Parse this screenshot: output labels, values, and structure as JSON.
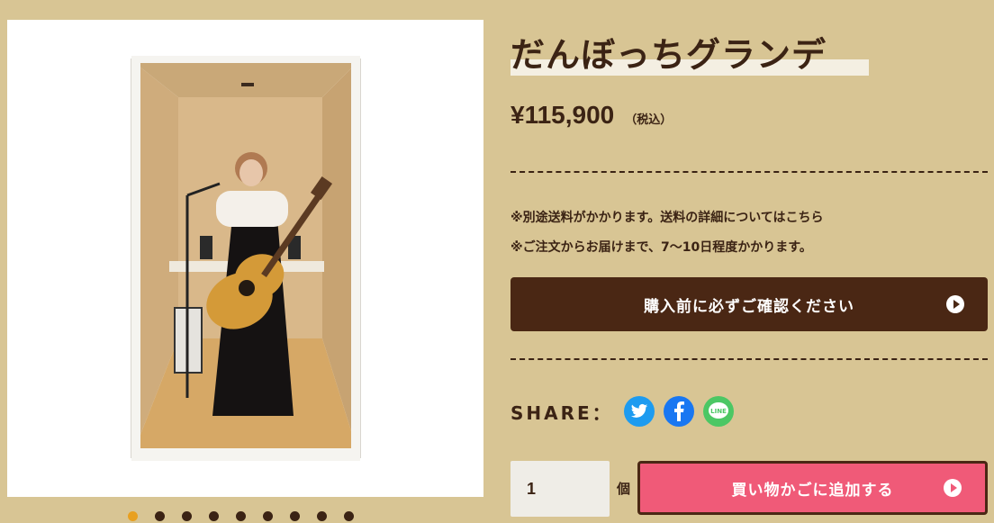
{
  "product": {
    "title": "だんぼっちグランデ",
    "price": "¥115,900",
    "tax_note": "（税込）",
    "notes": [
      "※別途送料がかかります。送料の詳細についてはこちら",
      "※ご注文からお届けまで、7〜10日程度かかります。"
    ],
    "image_alt": "product-photo-booth-with-guitarist"
  },
  "carousel": {
    "total": 9,
    "active_index": 0
  },
  "buttons": {
    "confirm_label": "購入前に必ずご確認ください",
    "cart_label": "買い物かごに追加する"
  },
  "share": {
    "label": "SHARE：",
    "icons": [
      "twitter-icon",
      "facebook-icon",
      "line-icon"
    ]
  },
  "quantity": {
    "value": "1",
    "unit": "個"
  },
  "colors": {
    "background": "#d8c594",
    "brown": "#4a2714",
    "cart_pink": "#f05a78",
    "active_dot": "#e8a020"
  }
}
